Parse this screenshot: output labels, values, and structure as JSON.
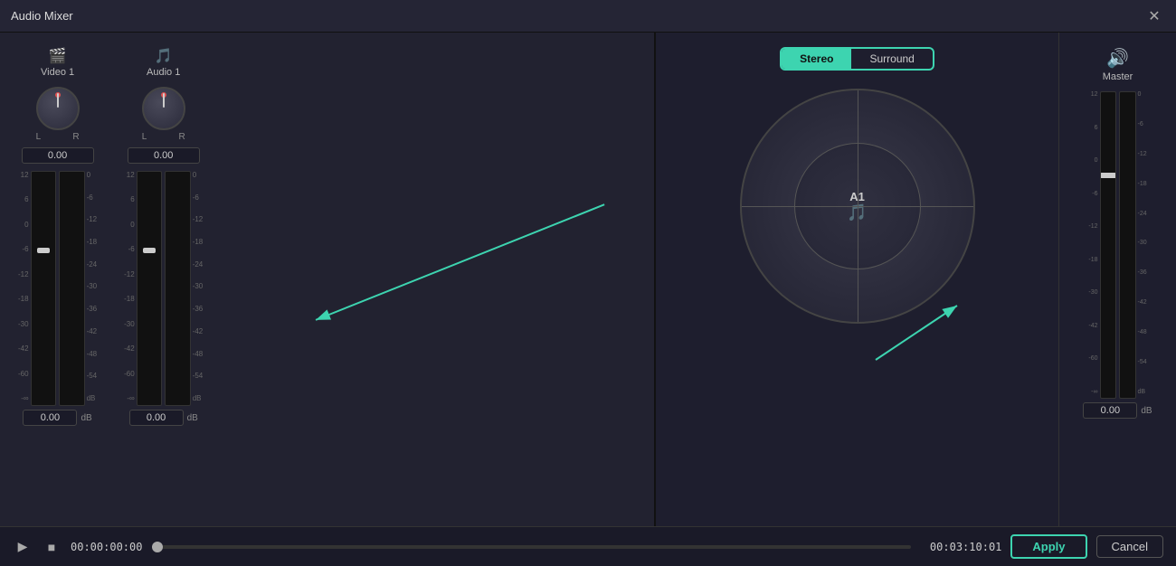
{
  "window": {
    "title": "Audio Mixer"
  },
  "tracks": [
    {
      "icon": "🎬",
      "name": "Video 1",
      "value": "0.00",
      "db": "0.00"
    },
    {
      "icon": "🎵",
      "name": "Audio 1",
      "value": "0.00",
      "db": "0.00"
    }
  ],
  "stereo_surround": {
    "stereo_label": "Stereo",
    "surround_label": "Surround",
    "track_label": "A1"
  },
  "master": {
    "label": "Master",
    "db": "0.00"
  },
  "scale_left": [
    "12",
    "6",
    "0",
    "-6",
    "-12",
    "-18",
    "-30",
    "-42",
    "-60",
    "-∞"
  ],
  "scale_right": [
    "0",
    "-6",
    "-12",
    "-18",
    "-24",
    "-30",
    "-36",
    "-42",
    "-48",
    "-54",
    "dB"
  ],
  "master_scale_left": [
    "12",
    "6",
    "0",
    "-6",
    "-12",
    "-18",
    "-30",
    "-42",
    "-60",
    "-∞"
  ],
  "master_scale_right": [
    "0",
    "-6",
    "-12",
    "-18",
    "-24",
    "-30",
    "-36",
    "-42",
    "-48",
    "-54",
    "dB"
  ],
  "bottom": {
    "time": "00:00:00:00",
    "duration": "00:03:10:01",
    "apply_label": "Apply",
    "cancel_label": "Cancel"
  }
}
